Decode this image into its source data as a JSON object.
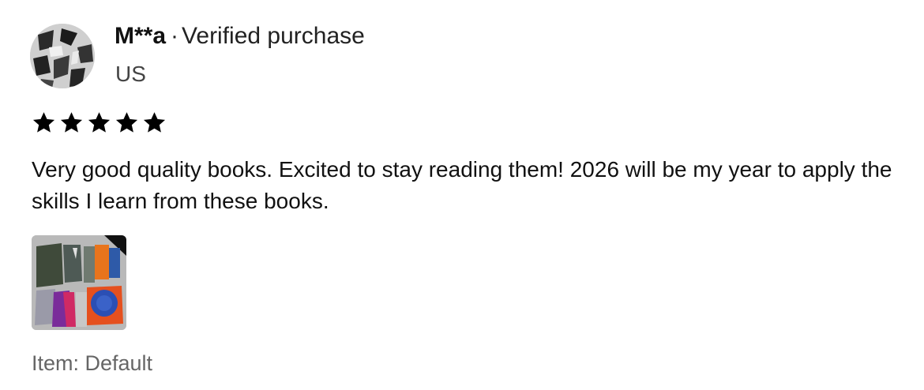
{
  "reviewer": {
    "name": "M**a",
    "separator": "·",
    "badge": "Verified purchase",
    "country": "US",
    "avatar_icon": "user-avatar-photo"
  },
  "rating": {
    "value": 5,
    "max": 5,
    "star_color": "#000000",
    "star_icon": "star-icon"
  },
  "review": {
    "text": "Very good quality books. Excited to stay reading them! 2026 will be my year to apply the skills I learn from these books."
  },
  "photo": {
    "icon": "review-photo-thumbnail"
  },
  "item": {
    "label": "Item: Default"
  }
}
